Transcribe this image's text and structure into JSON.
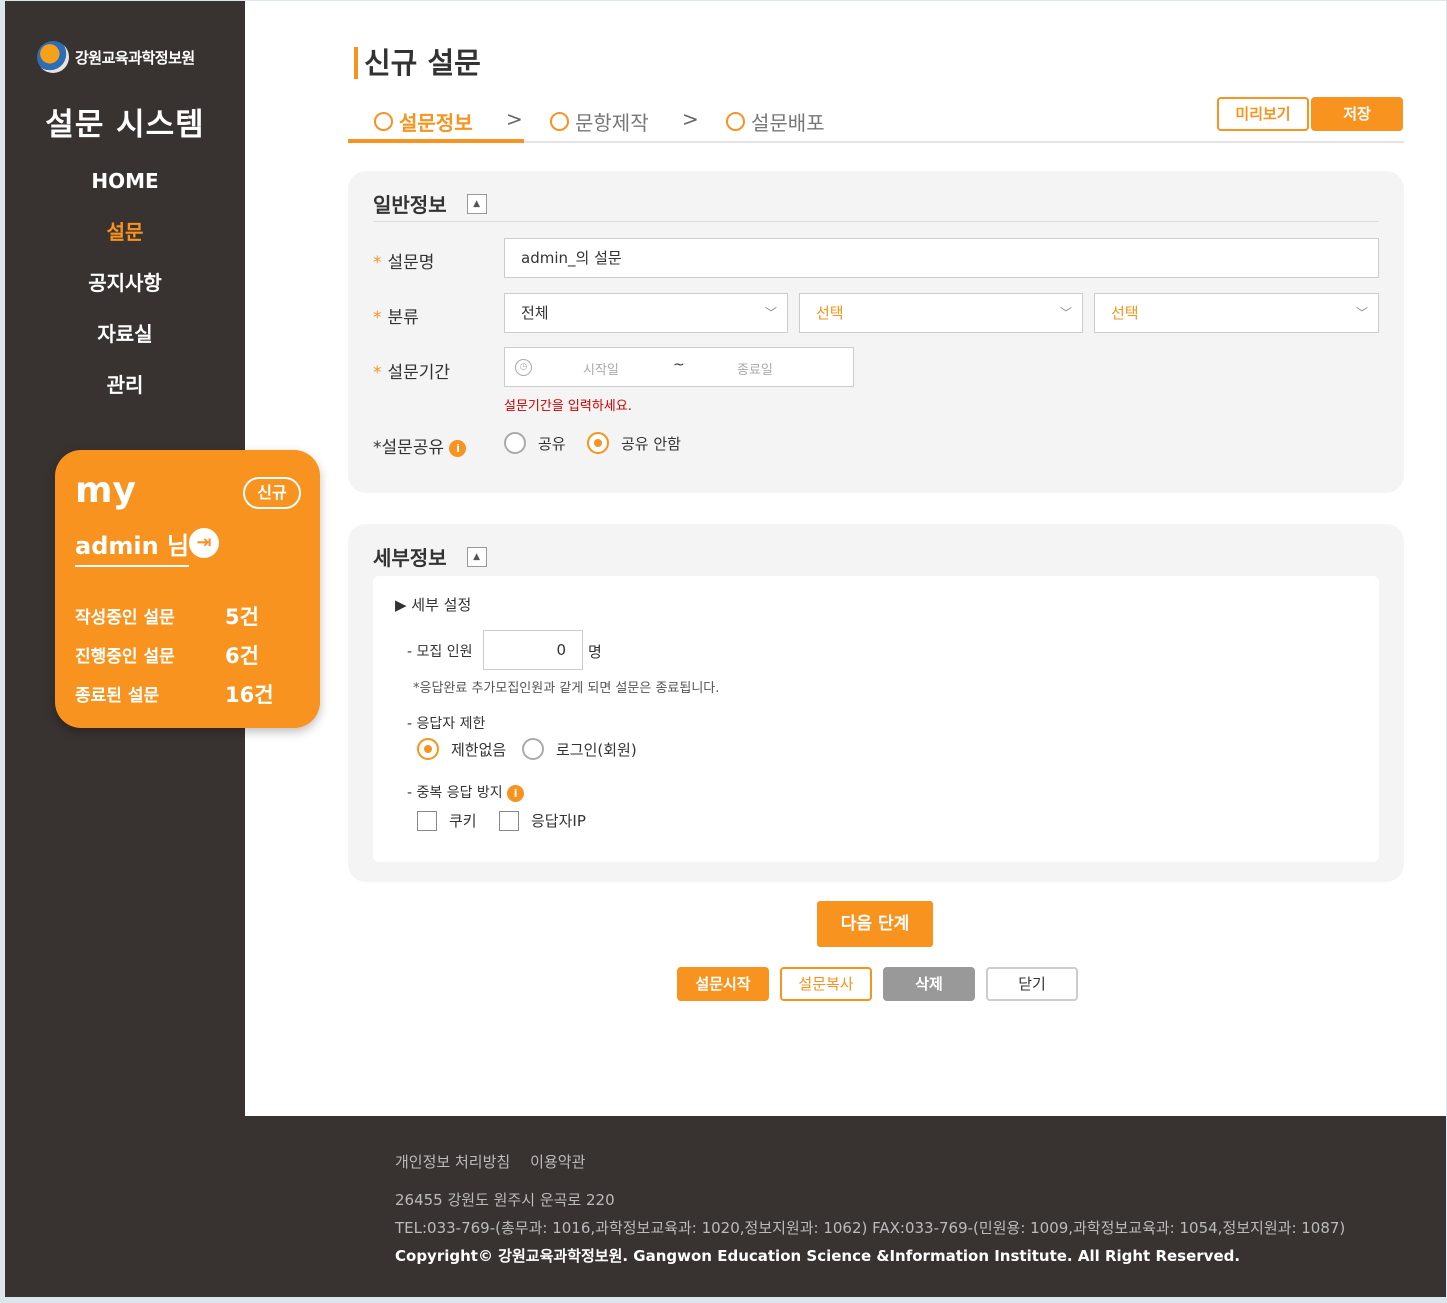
{
  "sidebar": {
    "logo_text": "강원교육과학정보원",
    "system_title": "설문 시스템",
    "nav": [
      {
        "label": "HOME"
      },
      {
        "label": "설문"
      },
      {
        "label": "공지사항"
      },
      {
        "label": "자료실"
      },
      {
        "label": "관리"
      }
    ],
    "active_nav": "설문",
    "my_card": {
      "label": "my",
      "new_button": "신규",
      "user": "admin 님",
      "stats": [
        {
          "label": "작성중인 설문",
          "value": "5건"
        },
        {
          "label": "진행중인 설문",
          "value": "6건"
        },
        {
          "label": "종료된 설문",
          "value": "16건"
        }
      ]
    }
  },
  "header": {
    "title": "신규 설문",
    "steps": [
      {
        "label": "설문정보"
      },
      {
        "label": "문항제작"
      },
      {
        "label": "설문배포"
      }
    ],
    "active_step": "설문정보",
    "step_separator": ">",
    "preview_label": "미리보기",
    "save_label": "저장"
  },
  "general": {
    "title": "일반정보",
    "required_mark": "*",
    "name_label": "설문명",
    "name_value": "admin_의 설문",
    "category_label": "분류",
    "category_selects": [
      "전체",
      "선택",
      "선택"
    ],
    "period_label": "설문기간",
    "period_start_placeholder": "시작일",
    "period_sep": "~",
    "period_end_placeholder": "종료일",
    "period_error": "설문기간을 입력하세요.",
    "share_label": "*설문공유",
    "share_options": [
      "공유",
      "공유 안함"
    ],
    "share_selected": "공유 안함"
  },
  "detail": {
    "title": "세부정보",
    "settings_heading": "▶ 세부 설정",
    "recruit_label": "- 모집 인원",
    "recruit_value": "0",
    "recruit_unit": "명",
    "recruit_note": "*응답완료 추가모집인원과 같게 되면 설문은 종료됩니다.",
    "limit_label": "- 응답자 제한",
    "limit_options": [
      "제한없음",
      "로그인(회원)"
    ],
    "limit_selected": "제한없음",
    "dup_label": "- 중복 응답 방지",
    "dup_options": [
      "쿠키",
      "응답자IP"
    ]
  },
  "actions": {
    "next": "다음 단계",
    "start": "설문시작",
    "copy": "설문복사",
    "delete": "삭제",
    "close": "닫기"
  },
  "footer": {
    "links": [
      "개인정보 처리방침",
      "이용약관"
    ],
    "address": "26455 강원도 원주시 운곡로 220",
    "tel": "TEL:033-769-(총무과: 1016,과학정보교육과: 1020,정보지원과: 1062) FAX:033-769-(민원용: 1009,과학정보교육과: 1054,정보지원과: 1087)",
    "copyright": "Copyright© 강원교육과학정보원. Gangwon Education Science &Information Institute. All Right Reserved."
  },
  "colors": {
    "accent": "#f7931e",
    "sidebar_bg": "#383230",
    "error": "#cc0000"
  },
  "icons": [
    "logo-icon",
    "logout-icon",
    "info-icon",
    "clock-icon",
    "chevron-down-icon",
    "collapse-icon"
  ]
}
